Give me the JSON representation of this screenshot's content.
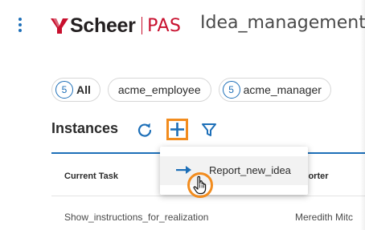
{
  "header": {
    "logo_text": "Scheer",
    "logo_product": "PAS",
    "app_title": "Idea_management"
  },
  "filters": [
    {
      "count": "5",
      "label": "All"
    },
    {
      "count": "",
      "label": "acme_employee"
    },
    {
      "count": "5",
      "label": "acme_manager"
    }
  ],
  "instances": {
    "title": "Instances"
  },
  "table": {
    "columns": [
      "Current Task",
      "Supporter"
    ],
    "visible_column_text": [
      "Current Task",
      "pporter"
    ],
    "rows": [
      {
        "task": "Show_instructions_for_realization",
        "supporter": "Meredith Mitc"
      }
    ]
  },
  "add_menu": {
    "items": [
      {
        "label": "Report_new_idea"
      }
    ]
  },
  "colors": {
    "accent_blue": "#1d6fb8",
    "highlight_orange": "#f28c1e",
    "brand_red": "#c8102e"
  },
  "icons": [
    "kebab-menu-icon",
    "refresh-icon",
    "add-icon",
    "filter-icon",
    "arrow-right-icon",
    "hand-pointer-icon"
  ]
}
